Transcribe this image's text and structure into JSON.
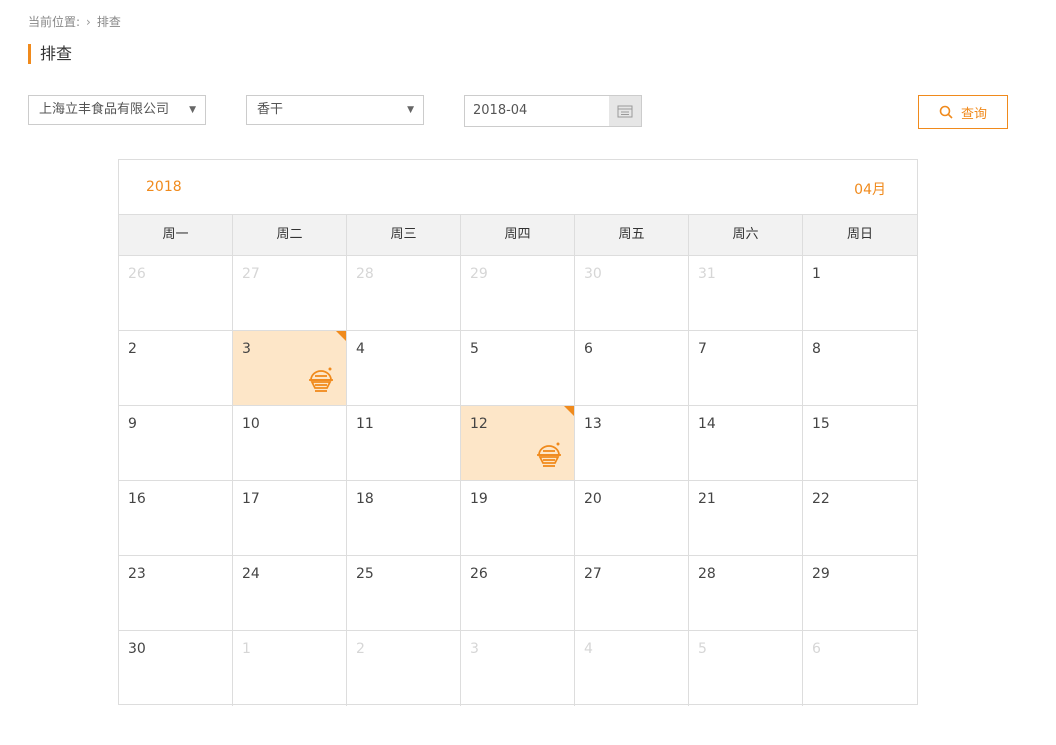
{
  "breadcrumb": {
    "label": "当前位置:",
    "current": "排查"
  },
  "page_title": "排查",
  "filters": {
    "company": "上海立丰食品有限公司",
    "product": "香干",
    "date": "2018-04",
    "search_label": "查询"
  },
  "accent_color": "#f08a1c",
  "highlight_color": "#fde6c8",
  "calendar": {
    "year": "2018",
    "month": "04月",
    "weekdays": [
      "周一",
      "周二",
      "周三",
      "周四",
      "周五",
      "周六",
      "周日"
    ],
    "days": [
      {
        "d": "26",
        "other": true
      },
      {
        "d": "27",
        "other": true
      },
      {
        "d": "28",
        "other": true
      },
      {
        "d": "29",
        "other": true
      },
      {
        "d": "30",
        "other": true
      },
      {
        "d": "31",
        "other": true
      },
      {
        "d": "1"
      },
      {
        "d": "2"
      },
      {
        "d": "3",
        "marked": true
      },
      {
        "d": "4"
      },
      {
        "d": "5"
      },
      {
        "d": "6"
      },
      {
        "d": "7"
      },
      {
        "d": "8"
      },
      {
        "d": "9"
      },
      {
        "d": "10"
      },
      {
        "d": "11"
      },
      {
        "d": "12",
        "marked": true
      },
      {
        "d": "13"
      },
      {
        "d": "14"
      },
      {
        "d": "15"
      },
      {
        "d": "16"
      },
      {
        "d": "17"
      },
      {
        "d": "18"
      },
      {
        "d": "19"
      },
      {
        "d": "20"
      },
      {
        "d": "21"
      },
      {
        "d": "22"
      },
      {
        "d": "23"
      },
      {
        "d": "24"
      },
      {
        "d": "25"
      },
      {
        "d": "26"
      },
      {
        "d": "27"
      },
      {
        "d": "28"
      },
      {
        "d": "29"
      },
      {
        "d": "30"
      },
      {
        "d": "1",
        "other": true
      },
      {
        "d": "2",
        "other": true
      },
      {
        "d": "3",
        "other": true
      },
      {
        "d": "4",
        "other": true
      },
      {
        "d": "5",
        "other": true
      },
      {
        "d": "6",
        "other": true
      }
    ],
    "marked_icon": "food-bowl-icon"
  }
}
